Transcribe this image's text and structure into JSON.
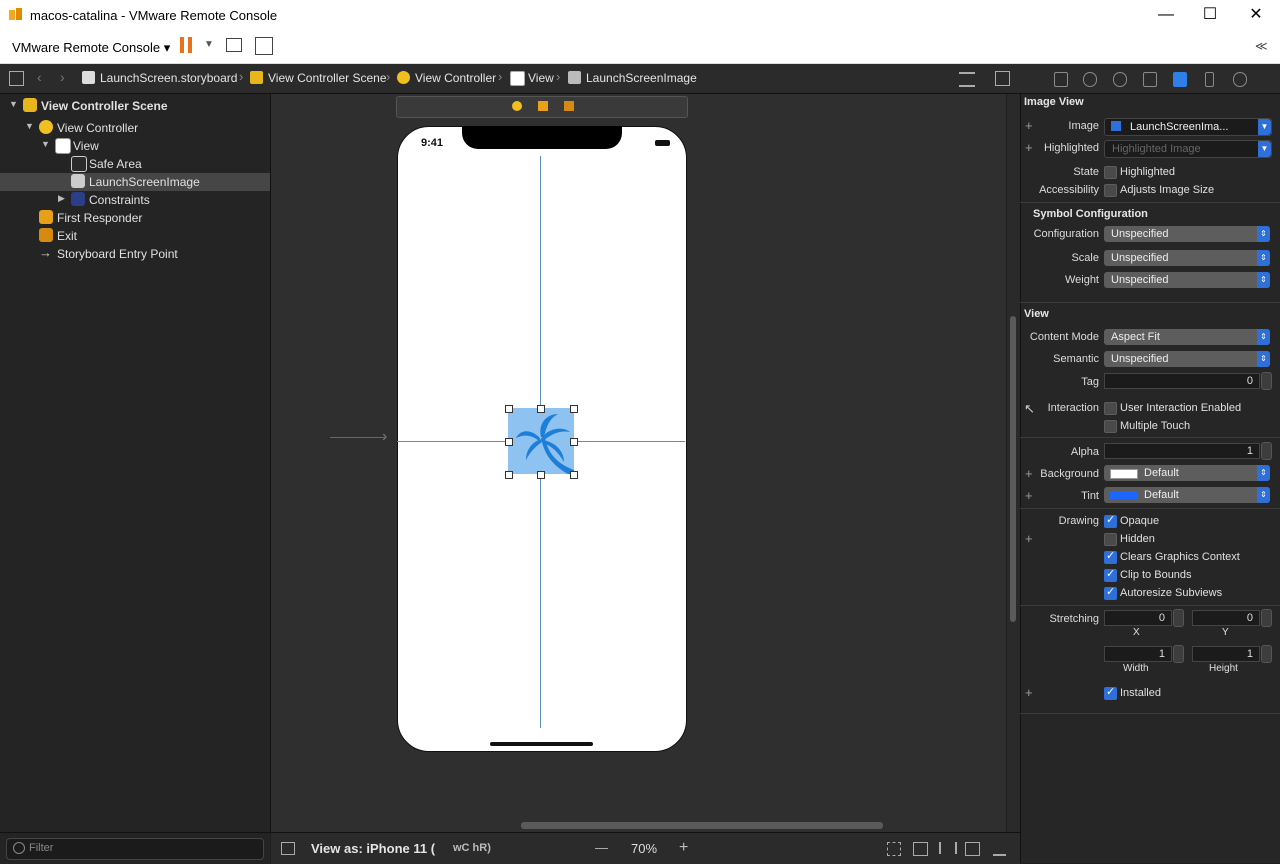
{
  "window": {
    "title": "macos-catalina - VMware Remote Console",
    "minimize": "—",
    "maximize": "☐",
    "close": "✕"
  },
  "menubar": {
    "menu_label": "VMware Remote Console ▾",
    "collapse": "≪"
  },
  "breadcrumbs": [
    "LaunchScreen.storyboard",
    "View Controller Scene",
    "View Controller",
    "View",
    "LaunchScreenImage"
  ],
  "outline": {
    "scene": "View Controller Scene",
    "controller": "View Controller",
    "view": "View",
    "safe_area": "Safe Area",
    "image": "LaunchScreenImage",
    "constraints": "Constraints",
    "first_responder": "First Responder",
    "exit": "Exit",
    "entry_point": "Storyboard Entry Point"
  },
  "filter_placeholder": "Filter",
  "phone": {
    "time": "9:41"
  },
  "canvas_bottom": {
    "view_as": "View as: iPhone 11 (",
    "trait": "wC hR)",
    "zoom": "70%",
    "minus": "—",
    "plus": "+"
  },
  "inspector": {
    "image_view": {
      "section": "Image View",
      "image_label": "Image",
      "image_value": "LaunchScreenIma...",
      "highlighted_label": "Highlighted",
      "highlighted_placeholder": "Highlighted Image",
      "state_label": "State",
      "state_value": "Highlighted",
      "accessibility_label": "Accessibility",
      "accessibility_value": "Adjusts Image Size"
    },
    "symbol": {
      "section": "Symbol Configuration",
      "configuration_label": "Configuration",
      "configuration_value": "Unspecified",
      "scale_label": "Scale",
      "scale_value": "Unspecified",
      "weight_label": "Weight",
      "weight_value": "Unspecified"
    },
    "view": {
      "section": "View",
      "content_mode_label": "Content Mode",
      "content_mode_value": "Aspect Fit",
      "semantic_label": "Semantic",
      "semantic_value": "Unspecified",
      "tag_label": "Tag",
      "tag_value": "0",
      "interaction_label": "Interaction",
      "user_interaction": "User Interaction Enabled",
      "multiple_touch": "Multiple Touch",
      "alpha_label": "Alpha",
      "alpha_value": "1",
      "background_label": "Background",
      "background_value": "Default",
      "tint_label": "Tint",
      "tint_value": "Default",
      "drawing_label": "Drawing",
      "opaque": "Opaque",
      "hidden": "Hidden",
      "clears": "Clears Graphics Context",
      "clip": "Clip to Bounds",
      "autoresize": "Autoresize Subviews",
      "stretching_label": "Stretching",
      "x_value": "0",
      "y_value": "0",
      "x_label": "X",
      "y_label": "Y",
      "width_value": "1",
      "height_value": "1",
      "width_label": "Width",
      "height_label": "Height",
      "installed": "Installed"
    }
  },
  "colors": {
    "accent": "#2e6fd8",
    "image_blue": "#8ec2f0",
    "palm": "#1e7fd8",
    "tint_swatch": "#1a66ff"
  }
}
